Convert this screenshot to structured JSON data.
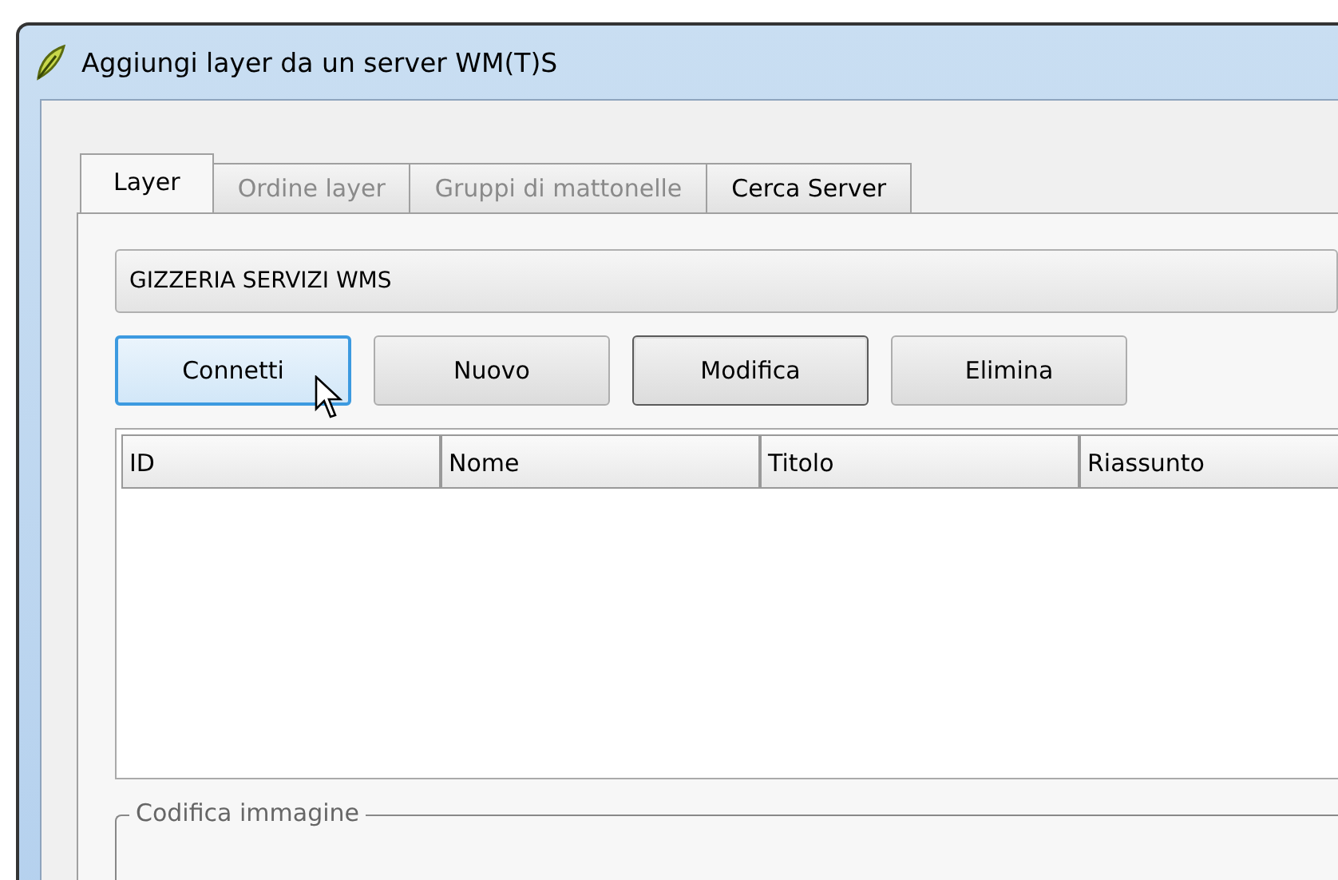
{
  "window": {
    "title": "Aggiungi layer da un server WM(T)S"
  },
  "tabs": [
    {
      "label": "Layer",
      "selected": true,
      "disabled": false
    },
    {
      "label": "Ordine layer",
      "selected": false,
      "disabled": true
    },
    {
      "label": "Gruppi di mattonelle",
      "selected": false,
      "disabled": true
    },
    {
      "label": "Cerca Server",
      "selected": false,
      "disabled": false
    }
  ],
  "server_select": {
    "value": "GIZZERIA SERVIZI WMS"
  },
  "buttons": [
    {
      "label": "Connetti",
      "focused": true,
      "default": false
    },
    {
      "label": "Nuovo",
      "focused": false,
      "default": false
    },
    {
      "label": "Modifica",
      "focused": false,
      "default": true
    },
    {
      "label": "Elimina",
      "focused": false,
      "default": false
    }
  ],
  "table": {
    "columns": [
      "ID",
      "Nome",
      "Titolo",
      "Riassunto"
    ]
  },
  "group_box": {
    "title": "Codifica immagine"
  }
}
